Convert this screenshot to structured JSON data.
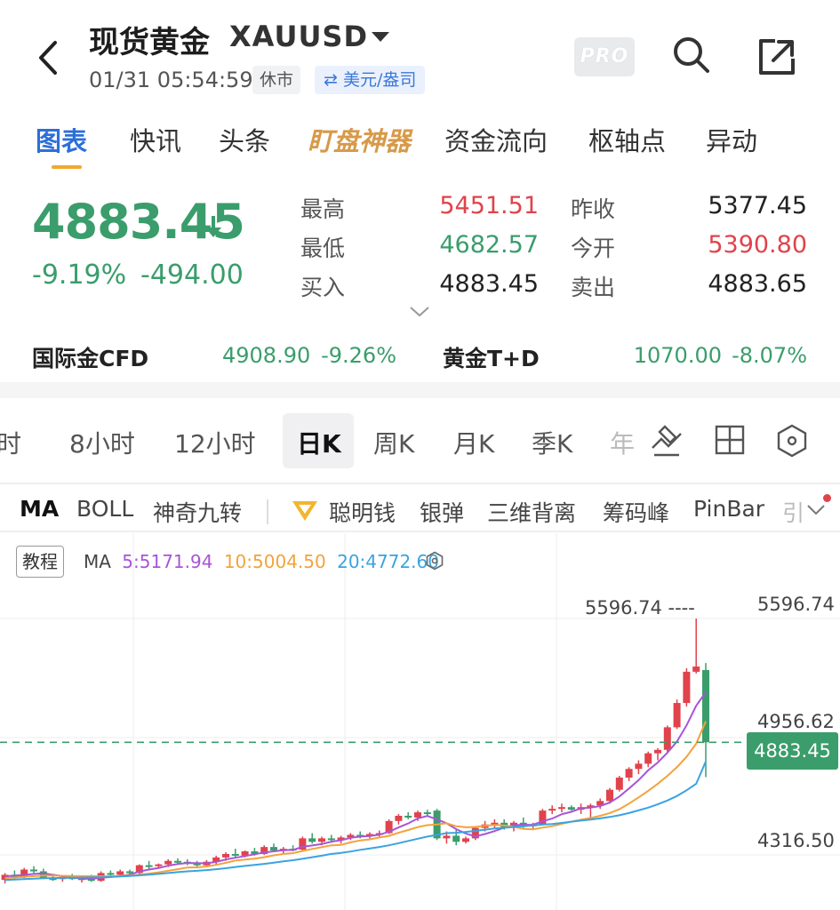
{
  "header": {
    "title": "现货黄金",
    "symbol": "XAUUSD",
    "timestamp": "01/31 05:54:59",
    "status": "休市",
    "currency": "⇄ 美元/盎司",
    "pro_label": "PRO"
  },
  "tabs": [
    {
      "label": "图表",
      "active": true
    },
    {
      "label": "快讯"
    },
    {
      "label": "头条"
    },
    {
      "label": "盯盘神器"
    },
    {
      "label": "资金流向"
    },
    {
      "label": "枢轴点"
    },
    {
      "label": "异动"
    }
  ],
  "quote": {
    "price": "4883.45",
    "change_pct": "-9.19%",
    "change_abs": "-494.00",
    "high_label": "最高",
    "high": "5451.51",
    "low_label": "最低",
    "low": "4682.57",
    "bid_label": "买入",
    "bid": "4883.45",
    "prev_close_label": "昨收",
    "prev_close": "5377.45",
    "open_label": "今开",
    "open": "5390.80",
    "ask_label": "卖出",
    "ask": "4883.65"
  },
  "related": [
    {
      "name": "国际金CFD",
      "price": "4908.90",
      "change": "-9.26%"
    },
    {
      "name": "黄金T+D",
      "price": "1070.00",
      "change": "-8.07%"
    }
  ],
  "periods": [
    "时",
    "8小时",
    "12小时",
    "日K",
    "周K",
    "月K",
    "季K",
    "年"
  ],
  "active_period": "日K",
  "indicators": [
    "MA",
    "BOLL",
    "神奇九转",
    "聪明钱",
    "银弹",
    "三维背离",
    "筹码峰",
    "PinBar",
    "引"
  ],
  "chart": {
    "tutorial_label": "教程",
    "ma_label": "MA",
    "ma5": "5:5171.94",
    "ma10": "10:5004.50",
    "ma20": "20:4772.60",
    "high_marker": "5596.74 ----",
    "axis_labels": [
      "5596.74",
      "4956.62",
      "4316.50"
    ],
    "last_price": "4883.45",
    "colors": {
      "up": "#e0434c",
      "down": "#3a9d6b",
      "ma5": "#a855d6",
      "ma10": "#f2a33a",
      "ma20": "#3aa3e0"
    }
  },
  "chart_data": {
    "type": "candlestick",
    "ylim": [
      4316.5,
      5596.74
    ],
    "candles": [
      {
        "o": 4090,
        "h": 4130,
        "l": 4070,
        "c": 4120
      },
      {
        "o": 4120,
        "h": 4145,
        "l": 4095,
        "c": 4105
      },
      {
        "o": 4105,
        "h": 4160,
        "l": 4100,
        "c": 4150
      },
      {
        "o": 4150,
        "h": 4170,
        "l": 4130,
        "c": 4140
      },
      {
        "o": 4140,
        "h": 4155,
        "l": 4095,
        "c": 4100
      },
      {
        "o": 4100,
        "h": 4120,
        "l": 4085,
        "c": 4095
      },
      {
        "o": 4095,
        "h": 4115,
        "l": 4080,
        "c": 4108
      },
      {
        "o": 4108,
        "h": 4125,
        "l": 4090,
        "c": 4095
      },
      {
        "o": 4095,
        "h": 4110,
        "l": 4075,
        "c": 4100
      },
      {
        "o": 4100,
        "h": 4120,
        "l": 4080,
        "c": 4085
      },
      {
        "o": 4085,
        "h": 4140,
        "l": 4080,
        "c": 4130
      },
      {
        "o": 4130,
        "h": 4145,
        "l": 4110,
        "c": 4120
      },
      {
        "o": 4120,
        "h": 4150,
        "l": 4110,
        "c": 4140
      },
      {
        "o": 4140,
        "h": 4150,
        "l": 4120,
        "c": 4130
      },
      {
        "o": 4130,
        "h": 4180,
        "l": 4120,
        "c": 4175
      },
      {
        "o": 4175,
        "h": 4200,
        "l": 4150,
        "c": 4170
      },
      {
        "o": 4170,
        "h": 4185,
        "l": 4155,
        "c": 4180
      },
      {
        "o": 4180,
        "h": 4210,
        "l": 4165,
        "c": 4200
      },
      {
        "o": 4200,
        "h": 4215,
        "l": 4185,
        "c": 4195
      },
      {
        "o": 4195,
        "h": 4210,
        "l": 4175,
        "c": 4185
      },
      {
        "o": 4185,
        "h": 4200,
        "l": 4165,
        "c": 4175
      },
      {
        "o": 4175,
        "h": 4205,
        "l": 4170,
        "c": 4195
      },
      {
        "o": 4195,
        "h": 4230,
        "l": 4180,
        "c": 4220
      },
      {
        "o": 4220,
        "h": 4250,
        "l": 4200,
        "c": 4240
      },
      {
        "o": 4240,
        "h": 4270,
        "l": 4220,
        "c": 4230
      },
      {
        "o": 4230,
        "h": 4260,
        "l": 4220,
        "c": 4255
      },
      {
        "o": 4255,
        "h": 4275,
        "l": 4230,
        "c": 4240
      },
      {
        "o": 4240,
        "h": 4290,
        "l": 4235,
        "c": 4280
      },
      {
        "o": 4280,
        "h": 4300,
        "l": 4250,
        "c": 4260
      },
      {
        "o": 4260,
        "h": 4280,
        "l": 4240,
        "c": 4270
      },
      {
        "o": 4270,
        "h": 4290,
        "l": 4255,
        "c": 4265
      },
      {
        "o": 4265,
        "h": 4340,
        "l": 4260,
        "c": 4330
      },
      {
        "o": 4330,
        "h": 4360,
        "l": 4300,
        "c": 4310
      },
      {
        "o": 4310,
        "h": 4340,
        "l": 4290,
        "c": 4330
      },
      {
        "o": 4330,
        "h": 4350,
        "l": 4305,
        "c": 4320
      },
      {
        "o": 4320,
        "h": 4345,
        "l": 4300,
        "c": 4335
      },
      {
        "o": 4335,
        "h": 4360,
        "l": 4320,
        "c": 4350
      },
      {
        "o": 4350,
        "h": 4370,
        "l": 4330,
        "c": 4345
      },
      {
        "o": 4345,
        "h": 4365,
        "l": 4330,
        "c": 4355
      },
      {
        "o": 4355,
        "h": 4375,
        "l": 4340,
        "c": 4360
      },
      {
        "o": 4360,
        "h": 4440,
        "l": 4355,
        "c": 4430
      },
      {
        "o": 4430,
        "h": 4470,
        "l": 4410,
        "c": 4460
      },
      {
        "o": 4460,
        "h": 4480,
        "l": 4440,
        "c": 4450
      },
      {
        "o": 4450,
        "h": 4490,
        "l": 4430,
        "c": 4480
      },
      {
        "o": 4480,
        "h": 4495,
        "l": 4460,
        "c": 4470
      },
      {
        "o": 4490,
        "h": 4500,
        "l": 4320,
        "c": 4330
      },
      {
        "o": 4330,
        "h": 4370,
        "l": 4300,
        "c": 4345
      },
      {
        "o": 4345,
        "h": 4380,
        "l": 4290,
        "c": 4310
      },
      {
        "o": 4310,
        "h": 4340,
        "l": 4300,
        "c": 4330
      },
      {
        "o": 4330,
        "h": 4400,
        "l": 4320,
        "c": 4390
      },
      {
        "o": 4390,
        "h": 4430,
        "l": 4370,
        "c": 4410
      },
      {
        "o": 4410,
        "h": 4440,
        "l": 4390,
        "c": 4420
      },
      {
        "o": 4420,
        "h": 4440,
        "l": 4380,
        "c": 4390
      },
      {
        "o": 4390,
        "h": 4430,
        "l": 4370,
        "c": 4420
      },
      {
        "o": 4420,
        "h": 4450,
        "l": 4390,
        "c": 4400
      },
      {
        "o": 4400,
        "h": 4420,
        "l": 4380,
        "c": 4410
      },
      {
        "o": 4410,
        "h": 4500,
        "l": 4405,
        "c": 4490
      },
      {
        "o": 4490,
        "h": 4520,
        "l": 4470,
        "c": 4500
      },
      {
        "o": 4500,
        "h": 4530,
        "l": 4480,
        "c": 4510
      },
      {
        "o": 4510,
        "h": 4520,
        "l": 4490,
        "c": 4495
      },
      {
        "o": 4495,
        "h": 4530,
        "l": 4470,
        "c": 4510
      },
      {
        "o": 4510,
        "h": 4530,
        "l": 4440,
        "c": 4520
      },
      {
        "o": 4520,
        "h": 4560,
        "l": 4500,
        "c": 4545
      },
      {
        "o": 4545,
        "h": 4620,
        "l": 4530,
        "c": 4610
      },
      {
        "o": 4610,
        "h": 4690,
        "l": 4600,
        "c": 4680
      },
      {
        "o": 4680,
        "h": 4740,
        "l": 4660,
        "c": 4730
      },
      {
        "o": 4730,
        "h": 4780,
        "l": 4700,
        "c": 4760
      },
      {
        "o": 4760,
        "h": 4830,
        "l": 4740,
        "c": 4820
      },
      {
        "o": 4820,
        "h": 4850,
        "l": 4780,
        "c": 4840
      },
      {
        "o": 4840,
        "h": 4980,
        "l": 4820,
        "c": 4970
      },
      {
        "o": 4970,
        "h": 5130,
        "l": 4960,
        "c": 5110
      },
      {
        "o": 5110,
        "h": 5310,
        "l": 5090,
        "c": 5290
      },
      {
        "o": 5290,
        "h": 5596.74,
        "l": 5280,
        "c": 5320
      },
      {
        "o": 5300,
        "h": 5340,
        "l": 4682.57,
        "c": 4883.45
      }
    ],
    "ma5": [
      4110,
      4115,
      4118,
      4125,
      4128,
      4120,
      4112,
      4104,
      4098,
      4097,
      4103,
      4107,
      4113,
      4121,
      4139,
      4150,
      4159,
      4172,
      4182,
      4188,
      4187,
      4186,
      4194,
      4208,
      4218,
      4228,
      4238,
      4249,
      4255,
      4261,
      4263,
      4281,
      4289,
      4297,
      4311,
      4319,
      4333,
      4340,
      4343,
      4351,
      4368,
      4393,
      4416,
      4445,
      4459,
      4439,
      4417,
      4383,
      4358,
      4341,
      4355,
      4372,
      4392,
      4406,
      4408,
      4408,
      4428,
      4444,
      4469,
      4483,
      4503,
      4507,
      4516,
      4536,
      4571,
      4617,
      4665,
      4722,
      4767,
      4824,
      4888,
      4981,
      5094,
      5171.94
    ],
    "ma10": [
      4100,
      4104,
      4108,
      4112,
      4116,
      4115,
      4114,
      4113,
      4112,
      4112,
      4111,
      4111,
      4113,
      4115,
      4121,
      4127,
      4134,
      4143,
      4152,
      4162,
      4163,
      4168,
      4177,
      4189,
      4202,
      4208,
      4213,
      4221,
      4232,
      4240,
      4245,
      4257,
      4269,
      4279,
      4290,
      4292,
      4307,
      4318,
      4324,
      4335,
      4344,
      4362,
      4378,
      4395,
      4406,
      4410,
      4417,
      4400,
      4394,
      4396,
      4402,
      4407,
      4404,
      4397,
      4384,
      4382,
      4392,
      4400,
      4414,
      4426,
      4438,
      4447,
      4460,
      4476,
      4498,
      4530,
      4566,
      4604,
      4645,
      4690,
      4740,
      4800,
      4875,
      5004.5
    ],
    "ma20": [
      4090,
      4092,
      4095,
      4098,
      4100,
      4101,
      4102,
      4103,
      4104,
      4105,
      4106,
      4108,
      4110,
      4113,
      4117,
      4121,
      4125,
      4130,
      4135,
      4140,
      4143,
      4147,
      4152,
      4158,
      4165,
      4171,
      4177,
      4183,
      4190,
      4197,
      4204,
      4212,
      4221,
      4230,
      4240,
      4246,
      4254,
      4264,
      4272,
      4280,
      4290,
      4302,
      4315,
      4328,
      4340,
      4350,
      4360,
      4362,
      4367,
      4373,
      4380,
      4387,
      4391,
      4396,
      4400,
      4404,
      4409,
      4413,
      4419,
      4426,
      4432,
      4438,
      4445,
      4453,
      4463,
      4476,
      4491,
      4507,
      4526,
      4548,
      4574,
      4607,
      4644,
      4772.6
    ]
  }
}
